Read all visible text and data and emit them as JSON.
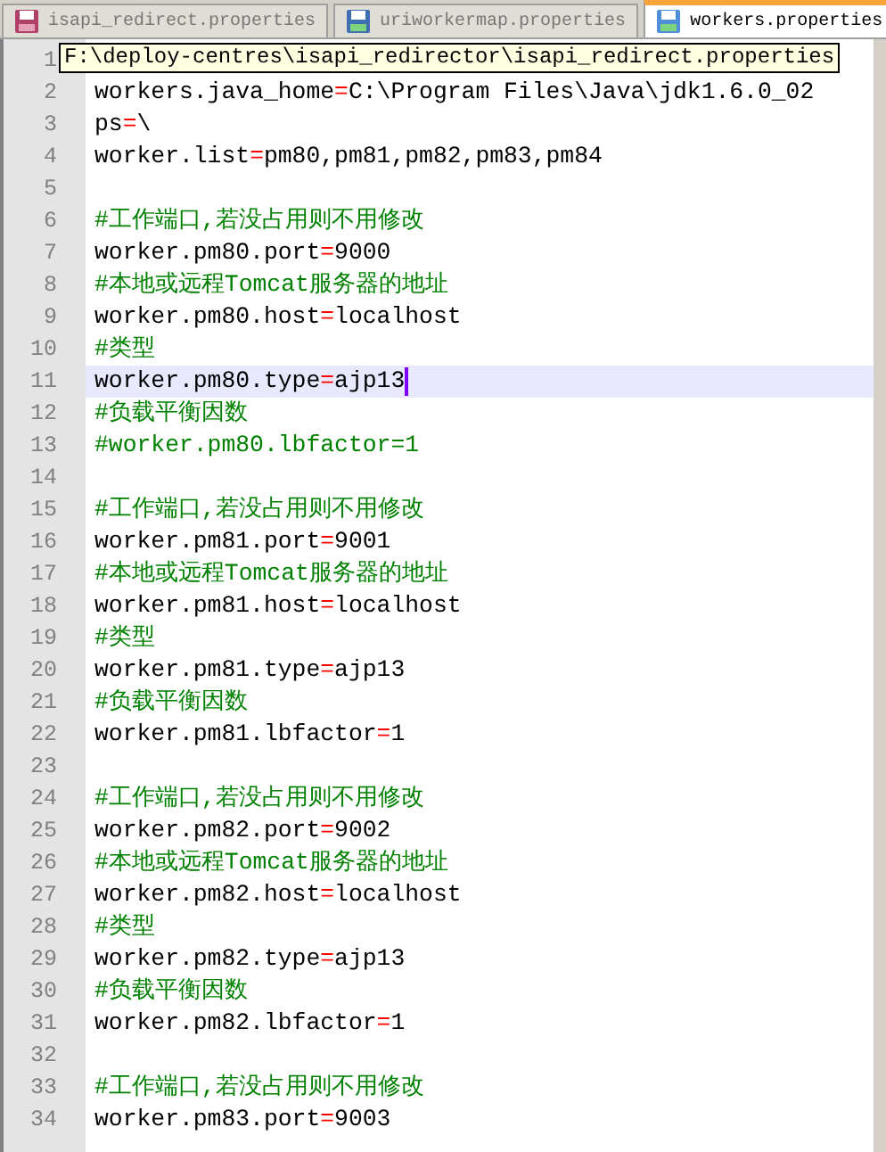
{
  "tabs": [
    {
      "label": "isapi_redirect.properties",
      "selected": false,
      "modified": true
    },
    {
      "label": "uriworkermap.properties",
      "selected": false,
      "modified": false
    },
    {
      "label": "workers.properties",
      "selected": true,
      "modified": false
    }
  ],
  "tooltip": "F:\\deploy-centres\\isapi_redirector\\isapi_redirect.properties",
  "lines": [
    {
      "number": "1",
      "kind": "blank",
      "current": false
    },
    {
      "number": "2",
      "kind": "code",
      "key": "workers.java_home",
      "op": "=",
      "value": "C:\\Program Files\\Java\\jdk1.6.0_02",
      "current": false
    },
    {
      "number": "3",
      "kind": "code",
      "key": "ps",
      "op": "=",
      "value": "\\",
      "current": false
    },
    {
      "number": "4",
      "kind": "code",
      "key": "worker.list",
      "op": "=",
      "value": "pm80,pm81,pm82,pm83,pm84",
      "current": false
    },
    {
      "number": "5",
      "kind": "blank",
      "current": false
    },
    {
      "number": "6",
      "kind": "comment",
      "text": "#工作端口,若没占用则不用修改",
      "current": false
    },
    {
      "number": "7",
      "kind": "code",
      "key": "worker.pm80.port",
      "op": "=",
      "value": "9000",
      "current": false
    },
    {
      "number": "8",
      "kind": "comment",
      "text": "#本地或远程Tomcat服务器的地址",
      "current": false
    },
    {
      "number": "9",
      "kind": "code",
      "key": "worker.pm80.host",
      "op": "=",
      "value": "localhost",
      "current": false
    },
    {
      "number": "10",
      "kind": "comment",
      "text": "#类型",
      "current": false
    },
    {
      "number": "11",
      "kind": "code",
      "key": "worker.pm80.type",
      "op": "=",
      "value": "ajp13",
      "current": true
    },
    {
      "number": "12",
      "kind": "comment",
      "text": "#负载平衡因数",
      "current": false
    },
    {
      "number": "13",
      "kind": "comment",
      "text": "#worker.pm80.lbfactor=1",
      "current": false
    },
    {
      "number": "14",
      "kind": "blank",
      "current": false
    },
    {
      "number": "15",
      "kind": "comment",
      "text": "#工作端口,若没占用则不用修改",
      "current": false
    },
    {
      "number": "16",
      "kind": "code",
      "key": "worker.pm81.port",
      "op": "=",
      "value": "9001",
      "current": false
    },
    {
      "number": "17",
      "kind": "comment",
      "text": "#本地或远程Tomcat服务器的地址",
      "current": false
    },
    {
      "number": "18",
      "kind": "code",
      "key": "worker.pm81.host",
      "op": "=",
      "value": "localhost",
      "current": false
    },
    {
      "number": "19",
      "kind": "comment",
      "text": "#类型",
      "current": false
    },
    {
      "number": "20",
      "kind": "code",
      "key": "worker.pm81.type",
      "op": "=",
      "value": "ajp13",
      "current": false
    },
    {
      "number": "21",
      "kind": "comment",
      "text": "#负载平衡因数",
      "current": false
    },
    {
      "number": "22",
      "kind": "code",
      "key": "worker.pm81.lbfactor",
      "op": "=",
      "value": "1",
      "current": false
    },
    {
      "number": "23",
      "kind": "blank",
      "current": false
    },
    {
      "number": "24",
      "kind": "comment",
      "text": "#工作端口,若没占用则不用修改",
      "current": false
    },
    {
      "number": "25",
      "kind": "code",
      "key": "worker.pm82.port",
      "op": "=",
      "value": "9002",
      "current": false
    },
    {
      "number": "26",
      "kind": "comment",
      "text": "#本地或远程Tomcat服务器的地址",
      "current": false
    },
    {
      "number": "27",
      "kind": "code",
      "key": "worker.pm82.host",
      "op": "=",
      "value": "localhost",
      "current": false
    },
    {
      "number": "28",
      "kind": "comment",
      "text": "#类型",
      "current": false
    },
    {
      "number": "29",
      "kind": "code",
      "key": "worker.pm82.type",
      "op": "=",
      "value": "ajp13",
      "current": false
    },
    {
      "number": "30",
      "kind": "comment",
      "text": "#负载平衡因数",
      "current": false
    },
    {
      "number": "31",
      "kind": "code",
      "key": "worker.pm82.lbfactor",
      "op": "=",
      "value": "1",
      "current": false
    },
    {
      "number": "32",
      "kind": "blank",
      "current": false
    },
    {
      "number": "33",
      "kind": "comment",
      "text": "#工作端口,若没占用则不用修改",
      "current": false
    },
    {
      "number": "34",
      "kind": "code",
      "key": "worker.pm83.port",
      "op": "=",
      "value": "9003",
      "current": false
    }
  ]
}
